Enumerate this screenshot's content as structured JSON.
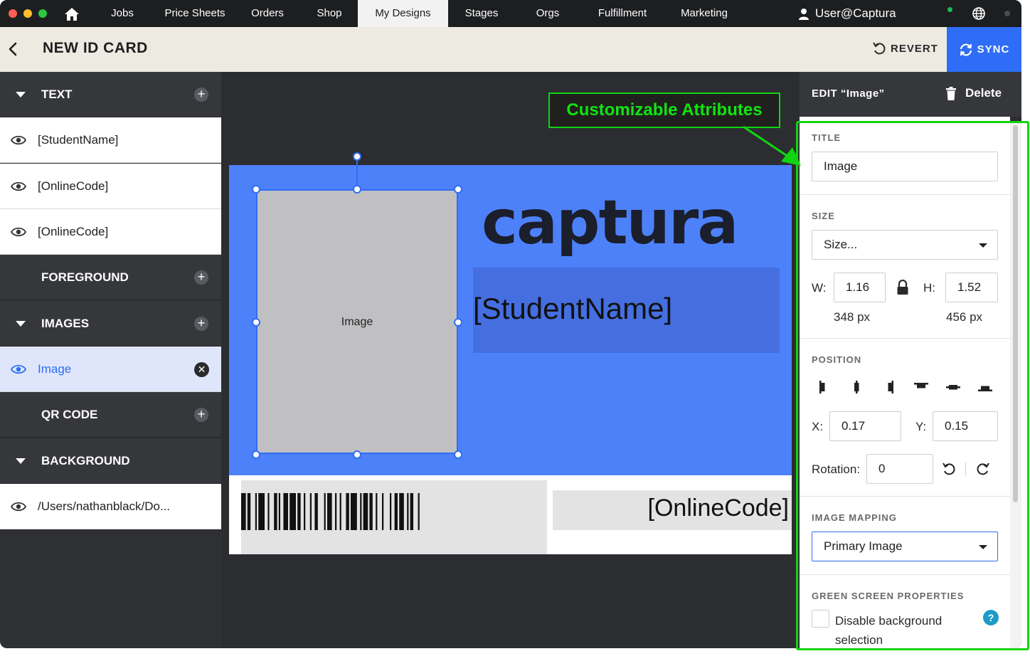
{
  "colors": {
    "accent": "#2f6df6",
    "annotation": "#11d411",
    "card_blue": "#4d81f9"
  },
  "nav": {
    "items": [
      "Jobs",
      "Price Sheets",
      "Orders",
      "Shop",
      "My Designs",
      "Stages",
      "Orgs",
      "Fulfillment",
      "Marketing"
    ],
    "active": "My Designs",
    "user": "User@Captura"
  },
  "header": {
    "title": "NEW ID CARD",
    "revert": "REVERT",
    "sync": "SYNC"
  },
  "layers": {
    "text_section": "TEXT",
    "text_items": [
      "[StudentName]",
      "[OnlineCode]",
      "[OnlineCode]"
    ],
    "foreground_section": "FOREGROUND",
    "images_section": "IMAGES",
    "image_item": "Image",
    "qr_section": "QR CODE",
    "background_section": "BACKGROUND",
    "background_item": "/Users/nathanblack/Do..."
  },
  "canvas": {
    "image_placeholder": "Image",
    "logo": "captura",
    "student_name": "[StudentName]",
    "online_code": "[OnlineCode]"
  },
  "annotation": {
    "label": "Customizable Attributes"
  },
  "properties": {
    "header": "EDIT “Image”",
    "delete": "Delete",
    "title_heading": "TITLE",
    "title_value": "Image",
    "size_heading": "SIZE",
    "size_value": "Size...",
    "w_label": "W:",
    "w_value": "1.16",
    "h_label": "H:",
    "h_value": "1.52",
    "w_px": "348 px",
    "h_px": "456 px",
    "position_heading": "POSITION",
    "x_label": "X:",
    "x_value": "0.17",
    "y_label": "Y:",
    "y_value": "0.15",
    "rotation_label": "Rotation:",
    "rotation_value": "0",
    "mapping_heading": "IMAGE MAPPING",
    "mapping_value": "Primary Image",
    "green_heading": "GREEN SCREEN PROPERTIES",
    "green_checkbox_label": "Disable background selection",
    "help": "?"
  }
}
